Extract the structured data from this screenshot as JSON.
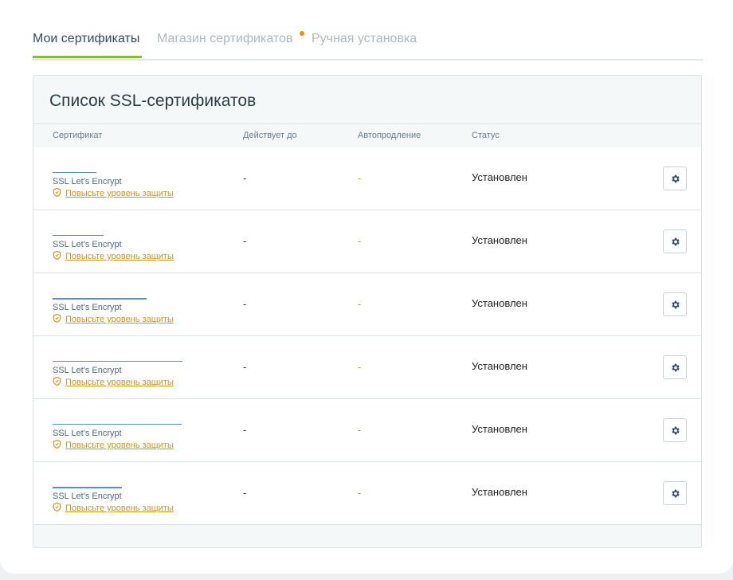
{
  "tabs": [
    {
      "label": "Мои сертификаты"
    },
    {
      "label": "Магазин сертификатов"
    },
    {
      "label": "Ручная установка"
    }
  ],
  "accent_color": "#7cc234",
  "notification_dot_color": "#ff8a00",
  "card": {
    "title": "Список SSL-сертификатов",
    "columns": [
      "Сертификат",
      "Действует до",
      "Автопродление",
      "Статус"
    ]
  },
  "rows": [
    {
      "cert": "SSL Let's Encrypt",
      "upgrade": "Повысьте уровень защиты",
      "valid_until": "-",
      "autorenew": "-",
      "status": "Установлен",
      "action_icon": "gear-icon"
    },
    {
      "cert": "SSL Let's Encrypt",
      "upgrade": "Повысьте уровень защиты",
      "valid_until": "-",
      "autorenew": "-",
      "status": "Установлен",
      "action_icon": "gear-icon"
    },
    {
      "cert": "SSL Let's Encrypt",
      "upgrade": "Повысьте уровень защиты",
      "valid_until": "-",
      "autorenew": "-",
      "status": "Установлен",
      "action_icon": "gear-icon"
    },
    {
      "cert": "SSL Let's Encrypt",
      "upgrade": "Повысьте уровень защиты",
      "valid_until": "-",
      "autorenew": "-",
      "status": "Установлен",
      "action_icon": "gear-icon"
    },
    {
      "cert": "SSL Let's Encrypt",
      "upgrade": "Повысьте уровень защиты",
      "valid_until": "-",
      "autorenew": "-",
      "status": "Установлен",
      "action_icon": "gear-icon"
    },
    {
      "cert": "SSL Let's Encrypt",
      "upgrade": "Повысьте уровень защиты",
      "valid_until": "-",
      "autorenew": "-",
      "status": "Установлен",
      "action_icon": "gear-icon"
    }
  ]
}
